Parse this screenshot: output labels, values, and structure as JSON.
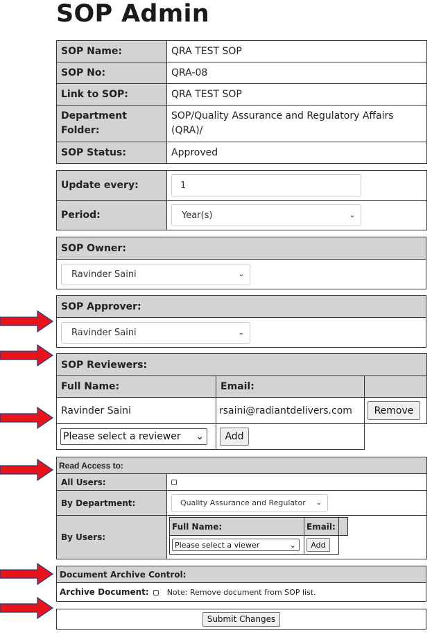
{
  "page": {
    "title": "SOP Admin"
  },
  "sop_info": {
    "rows": [
      {
        "label": "SOP Name:",
        "value": "QRA TEST SOP"
      },
      {
        "label": "SOP No:",
        "value": "QRA-08"
      },
      {
        "label": "Link to SOP:",
        "value": "QRA TEST SOP"
      },
      {
        "label": "Department Folder:",
        "value": "SOP/Quality Assurance and Regulatory Affairs (QRA)/"
      },
      {
        "label": "SOP Status:",
        "value": "Approved"
      }
    ]
  },
  "update": {
    "every_label": "Update every:",
    "every_value": "1",
    "period_label": "Period:",
    "period_value": "Year(s)"
  },
  "owner": {
    "label": "SOP Owner:",
    "selected": "Ravinder Saini"
  },
  "approver": {
    "label": "SOP Approver:",
    "selected": "Ravinder Saini"
  },
  "reviewers": {
    "label": "SOP Reviewers:",
    "col_name": "Full Name:",
    "col_email": "Email:",
    "rows": [
      {
        "name": "Ravinder Saini",
        "email": "rsaini@radiantdelivers.com",
        "action": "Remove"
      }
    ],
    "select_placeholder": "Please select a reviewer",
    "add_label": "Add"
  },
  "read_access": {
    "label": "Read Access to:",
    "all_users_label": "All Users:",
    "by_department_label": "By Department:",
    "department_selected": "Quality Assurance and Regulator",
    "by_users_label": "By Users:",
    "col_name": "Full Name:",
    "col_email": "Email:",
    "viewer_placeholder": "Please select a viewer",
    "add_label": "Add"
  },
  "archive": {
    "label": "Document Archive Control:",
    "archive_label": "Archive Document:",
    "note": "Note: Remove document from SOP list."
  },
  "submit_label": "Submit Changes",
  "colors": {
    "header_bg": "#d3d3d3",
    "arrow": "#e8141b",
    "arrow_outline": "#1f3b7a"
  }
}
